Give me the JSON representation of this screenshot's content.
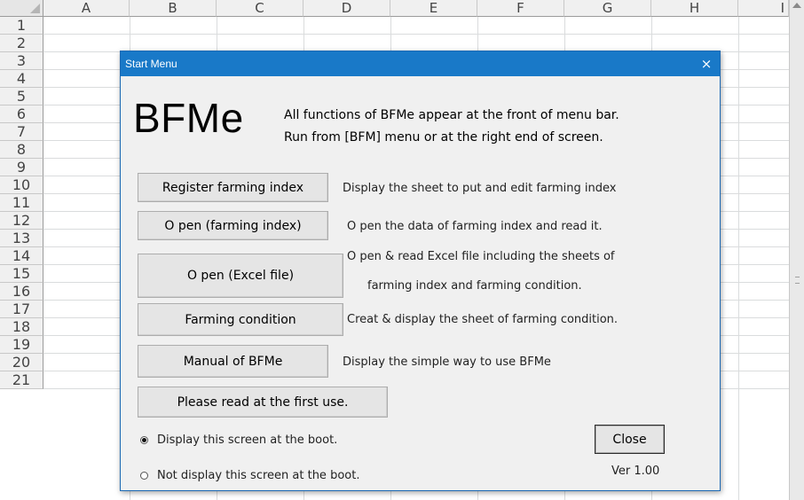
{
  "spreadsheet": {
    "columns": [
      "A",
      "B",
      "C",
      "D",
      "E",
      "F",
      "G",
      "H",
      "I"
    ],
    "rows": [
      "1",
      "2",
      "3",
      "4",
      "5",
      "6",
      "7",
      "8",
      "9",
      "10",
      "11",
      "12",
      "13",
      "14",
      "15",
      "16",
      "17",
      "18",
      "19",
      "20",
      "21"
    ]
  },
  "dialog": {
    "title": "Start Menu",
    "close_glyph": "×",
    "logo": "BFMe",
    "header_line1": "All functions of BFMe appear at the front of menu bar.",
    "header_line2": "Run from [BFM] menu or at the right end of screen.",
    "buttons": [
      {
        "label": "Register farming index",
        "desc": [
          "Display the sheet to put and edit farming index"
        ]
      },
      {
        "label": "O pen (farming index)",
        "desc": [
          "O pen the data of farming index and read it."
        ]
      },
      {
        "label": "O pen (Excel file)",
        "desc": [
          "O pen & read Excel file including the sheets of",
          "farming index and farming condition."
        ]
      },
      {
        "label": "Farming condition",
        "desc": [
          "Creat & display the sheet of farming condition."
        ]
      },
      {
        "label": "Manual of BFMe",
        "desc": [
          "Display the simple way to use BFMe"
        ]
      },
      {
        "label": "Please read at the first use.",
        "desc": []
      }
    ],
    "radio_options": [
      {
        "label": "Display this screen at the boot.",
        "selected": true
      },
      {
        "label": "Not display this screen at the boot.",
        "selected": false
      }
    ],
    "close_button": "Close",
    "version": "Ver 1.00"
  },
  "colors": {
    "titlebar": "#1979c8",
    "dialog_bg": "#f0f0f0",
    "header_bg": "#f0f0f0",
    "gridline": "#dadcdd"
  }
}
